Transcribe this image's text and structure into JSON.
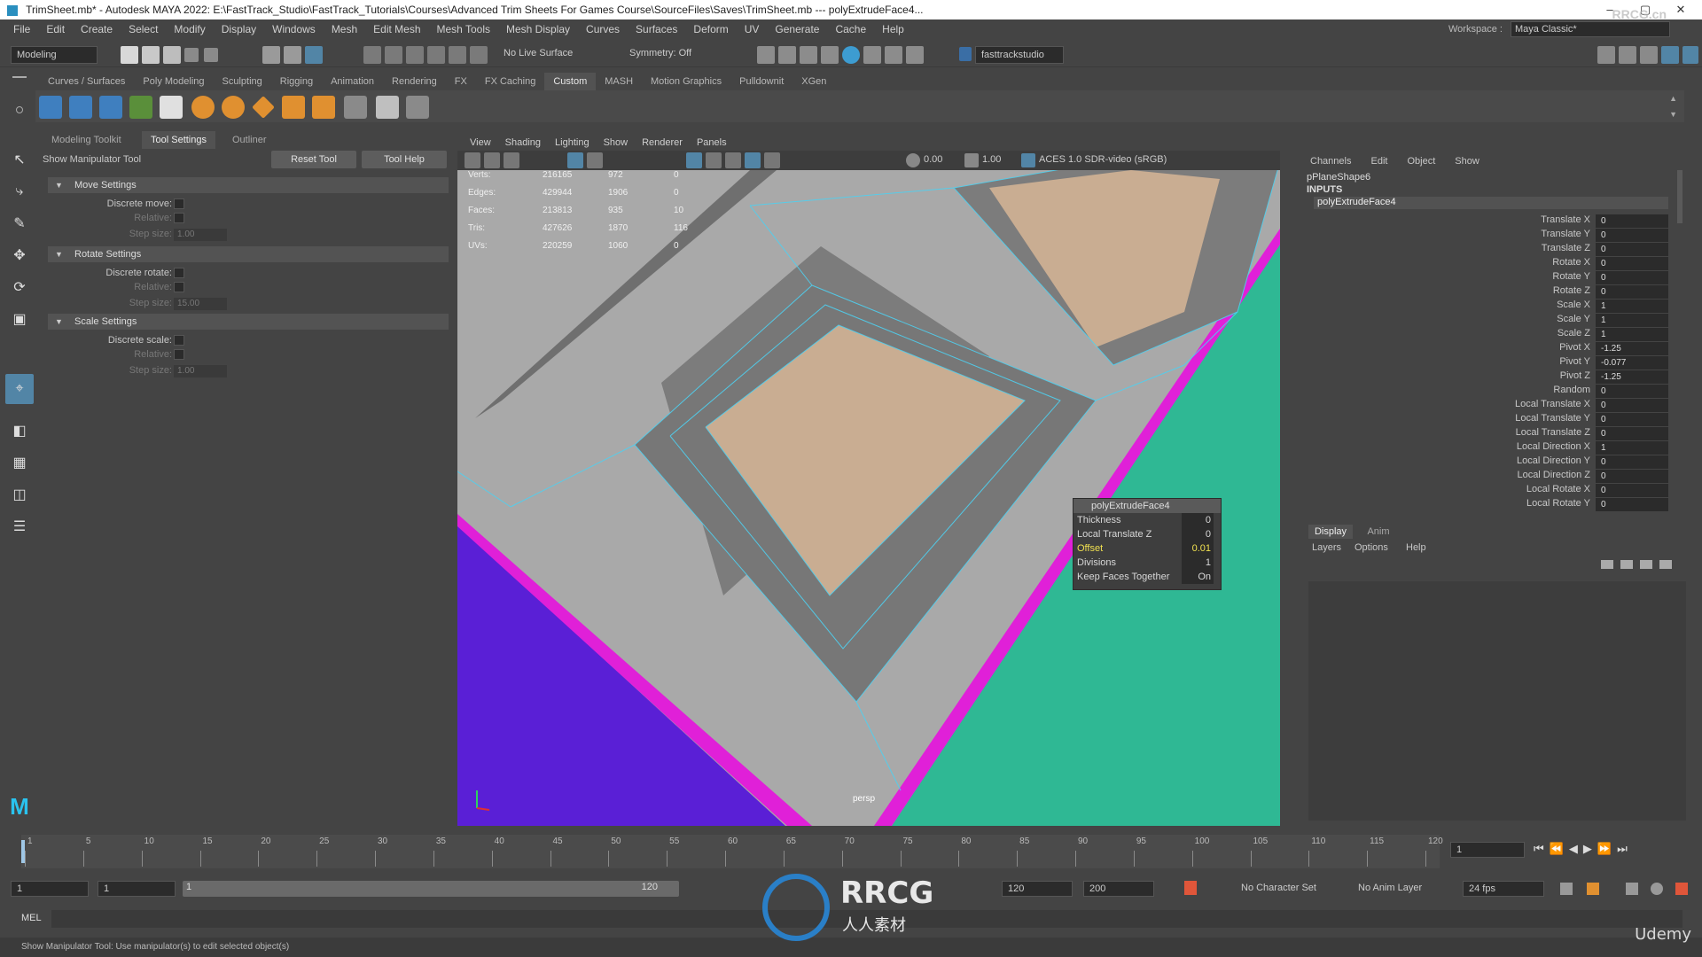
{
  "title_bar": {
    "text": "TrimSheet.mb* - Autodesk MAYA 2022: E:\\FastTrack_Studio\\FastTrack_Tutorials\\Courses\\Advanced Trim Sheets For Games Course\\SourceFiles\\Saves\\TrimSheet.mb   ---   polyExtrudeFace4..."
  },
  "menubar": [
    "File",
    "Edit",
    "Create",
    "Select",
    "Modify",
    "Display",
    "Windows",
    "Mesh",
    "Edit Mesh",
    "Mesh Tools",
    "Mesh Display",
    "Curves",
    "Surfaces",
    "Deform",
    "UV",
    "Generate",
    "Cache",
    "Help"
  ],
  "workspace": {
    "label": "Workspace :",
    "value": "Maya Classic*"
  },
  "status_line": {
    "mode": "Modeling",
    "live_surface": "No Live Surface",
    "symmetry": "Symmetry: Off",
    "user": "fasttrackstudio"
  },
  "shelf_tabs": [
    "Curves / Surfaces",
    "Poly Modeling",
    "Sculpting",
    "Rigging",
    "Animation",
    "Rendering",
    "FX",
    "FX Caching",
    "Custom",
    "MASH",
    "Motion Graphics",
    "Pulldownit",
    "XGen"
  ],
  "shelf_active": "Custom",
  "left_panel": {
    "tabs": [
      "Modeling Toolkit",
      "Tool Settings",
      "Outliner"
    ],
    "active_tab": "Tool Settings",
    "tool_name": "Show Manipulator Tool",
    "reset_button": "Reset Tool",
    "help_button": "Tool Help",
    "sections": [
      {
        "title": "Move Settings",
        "discrete": "Discrete move:",
        "relative": "Relative:",
        "step": "Step size:",
        "step_value": "1.00"
      },
      {
        "title": "Rotate Settings",
        "discrete": "Discrete rotate:",
        "relative": "Relative:",
        "step": "Step size:",
        "step_value": "15.00"
      },
      {
        "title": "Scale Settings",
        "discrete": "Discrete scale:",
        "relative": "Relative:",
        "step": "Step size:",
        "step_value": "1.00"
      }
    ]
  },
  "viewport": {
    "menu": [
      "View",
      "Shading",
      "Lighting",
      "Show",
      "Renderer",
      "Panels"
    ],
    "field_a": "0.00",
    "field_b": "1.00",
    "color_space": "ACES 1.0 SDR-video (sRGB)",
    "camera_label": "persp",
    "hud": [
      {
        "label": "Verts:",
        "v1": "216165",
        "v2": "972",
        "v3": "0"
      },
      {
        "label": "Edges:",
        "v1": "429944",
        "v2": "1906",
        "v3": "0"
      },
      {
        "label": "Faces:",
        "v1": "213813",
        "v2": "935",
        "v3": "10"
      },
      {
        "label": "Tris:",
        "v1": "427626",
        "v2": "1870",
        "v3": "116"
      },
      {
        "label": "UVs:",
        "v1": "220259",
        "v2": "1060",
        "v3": "0"
      }
    ],
    "popup": {
      "title": "polyExtrudeFace4",
      "rows": [
        {
          "label": "Thickness",
          "value": "0"
        },
        {
          "label": "Local Translate Z",
          "value": "0"
        },
        {
          "label": "Offset",
          "value": "0.01"
        },
        {
          "label": "Divisions",
          "value": "1"
        },
        {
          "label": "Keep Faces Together",
          "value": "On"
        }
      ]
    }
  },
  "channel_box": {
    "menu": [
      "Channels",
      "Edit",
      "Object",
      "Show"
    ],
    "shape": "pPlaneShape6",
    "inputs_label": "INPUTS",
    "node": "polyExtrudeFace4",
    "channels": [
      {
        "name": "Translate X",
        "value": "0"
      },
      {
        "name": "Translate Y",
        "value": "0"
      },
      {
        "name": "Translate Z",
        "value": "0"
      },
      {
        "name": "Rotate X",
        "value": "0"
      },
      {
        "name": "Rotate Y",
        "value": "0"
      },
      {
        "name": "Rotate Z",
        "value": "0"
      },
      {
        "name": "Scale X",
        "value": "1"
      },
      {
        "name": "Scale Y",
        "value": "1"
      },
      {
        "name": "Scale Z",
        "value": "1"
      },
      {
        "name": "Pivot X",
        "value": "-1.25"
      },
      {
        "name": "Pivot Y",
        "value": "-0.077"
      },
      {
        "name": "Pivot Z",
        "value": "-1.25"
      },
      {
        "name": "Random",
        "value": "0"
      },
      {
        "name": "Local Translate X",
        "value": "0"
      },
      {
        "name": "Local Translate Y",
        "value": "0"
      },
      {
        "name": "Local Translate Z",
        "value": "0"
      },
      {
        "name": "Local Direction X",
        "value": "1"
      },
      {
        "name": "Local Direction Y",
        "value": "0"
      },
      {
        "name": "Local Direction Z",
        "value": "0"
      },
      {
        "name": "Local Rotate X",
        "value": "0"
      },
      {
        "name": "Local Rotate Y",
        "value": "0"
      }
    ]
  },
  "layer_editor": {
    "tabs": [
      "Display",
      "Anim"
    ],
    "menu": [
      "Layers",
      "Options",
      "Help"
    ]
  },
  "timeline": {
    "ticks": [
      "1",
      "5",
      "10",
      "15",
      "20",
      "25",
      "30",
      "35",
      "40",
      "45",
      "50",
      "55",
      "60",
      "65",
      "70",
      "75",
      "80",
      "85",
      "90",
      "95",
      "100",
      "105",
      "110",
      "115",
      "120"
    ],
    "current_frame": "1"
  },
  "range": {
    "start": "1",
    "inner_start": "1",
    "slider_start": "1",
    "slider_end": "120",
    "inner_end": "120",
    "end": "200",
    "character_set": "No Character Set",
    "anim_layer": "No Anim Layer",
    "fps": "24 fps"
  },
  "mel_label": "MEL",
  "help_line": "Show Manipulator Tool: Use manipulator(s) to edit selected object(s)",
  "watermark": {
    "brand": "RRCG",
    "sub": "人人素材",
    "corner": "RRCG.cn"
  },
  "udemy": "Udemy",
  "colors": {
    "bg": "#444444",
    "field": "#2b2b2b",
    "accent": "#5285a6",
    "viewport_grey": "#a9a9a9",
    "beige": "#c9ad92",
    "teal": "#2fb894",
    "purple": "#5a1fd6",
    "magenta": "#e020d8",
    "wire": "#4fd0f0"
  }
}
